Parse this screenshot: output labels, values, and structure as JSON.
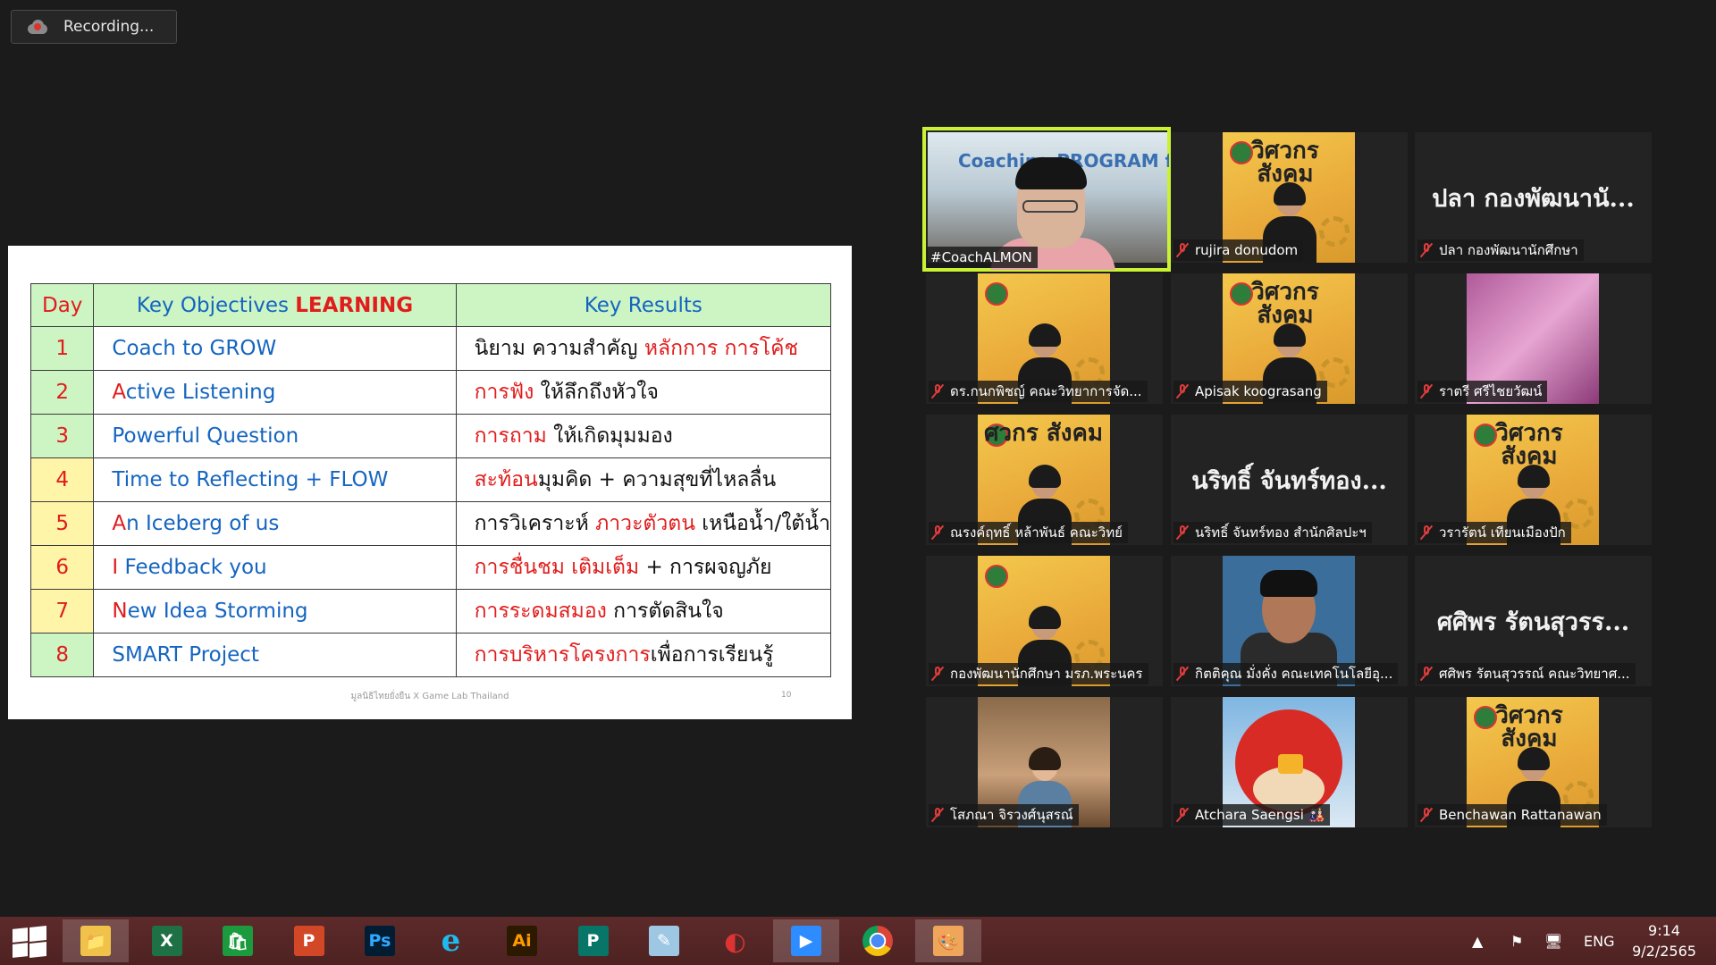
{
  "recording": {
    "label": "Recording..."
  },
  "slide": {
    "header": {
      "day": "Day",
      "objectives_prefix": "Key Objectives ",
      "objectives_highlight": "LEARNING",
      "results": "Key Results"
    },
    "rows": [
      {
        "day": "1",
        "obj_a": "",
        "obj_b": "Coach to GROW",
        "res_a": "นิยาม ความสำคัญ ",
        "res_b": "หลักการ การโค้ช",
        "res_c": ""
      },
      {
        "day": "2",
        "obj_a": "A",
        "obj_b": "ctive Listening",
        "res_a": "",
        "res_b": "การฟัง",
        "res_c": " ให้ลึกถึงหัวใจ"
      },
      {
        "day": "3",
        "obj_a": "",
        "obj_b": "Powerful Question",
        "res_a": "",
        "res_b": "การถาม",
        "res_c": " ให้เกิดมุมมอง"
      },
      {
        "day": "4",
        "obj_a": "",
        "obj_b": "Time to Reflecting + FLOW",
        "res_a": "",
        "res_b": "สะท้อน",
        "res_c": "มุมคิด + ความสุขที่ไหลลื่น"
      },
      {
        "day": "5",
        "obj_a": "A",
        "obj_b": "n Iceberg of us",
        "res_a": "การวิเคราะห์ ",
        "res_b": "ภาวะตัวตน",
        "res_c": " เหนือน้ำ/ใต้น้ำ"
      },
      {
        "day": "6",
        "obj_a": "I",
        "obj_b": " Feedback you",
        "res_a": "",
        "res_b": "การชื่นชม เติมเต็ม",
        "res_c": " + การผจญภัย"
      },
      {
        "day": "7",
        "obj_a": "N",
        "obj_b": "ew Idea Storming",
        "res_a": "",
        "res_b": "การระดมสมอง",
        "res_c": " การตัดสินใจ"
      },
      {
        "day": "8",
        "obj_a": "",
        "obj_b": "SMART Project",
        "res_a": "",
        "res_b": "การบริหารโครงการ",
        "res_c": "เพื่อการเรียนรู้"
      }
    ],
    "footer": "มูลนิธิไทยยั่งยืน X Game Lab Thailand",
    "page": "10"
  },
  "participants": [
    {
      "name": "#CoachALMON",
      "muted": false,
      "kind": "video",
      "overlay": "Coaching PROGRAM for Leader"
    },
    {
      "name": "rujira donudom",
      "muted": true,
      "kind": "poster",
      "poster_text": "วิศวกร สังคม"
    },
    {
      "name": "ปลา กองพัฒนานักศึกษา",
      "muted": true,
      "kind": "text",
      "big": "ปลา กองพัฒนานั..."
    },
    {
      "name": "ดร.กนกพิชญ์ คณะวิทยาการจัด...",
      "muted": true,
      "kind": "poster",
      "poster_text": ""
    },
    {
      "name": "Apisak koograsang",
      "muted": true,
      "kind": "poster",
      "poster_text": "วิศวกร สังคม"
    },
    {
      "name": "ราตรี ศรีไชยวัฒน์",
      "muted": true,
      "kind": "photo"
    },
    {
      "name": "ณรงค์ฤทธิ์ หล้าพันธ์ คณะวิทย์",
      "muted": true,
      "kind": "poster",
      "poster_text": "ศวกร สังคม"
    },
    {
      "name": "นริทธิ์ จันทร์ทอง สำนักศิลปะฯ",
      "muted": true,
      "kind": "text",
      "big": "นริทธิ์ จันทร์ทอง..."
    },
    {
      "name": "วรารัตน์ เทียนเมืองปัก",
      "muted": true,
      "kind": "poster",
      "poster_text": "วิศวกร สังคม"
    },
    {
      "name": "กองพัฒนานักศึกษา มรภ.พระนคร",
      "muted": true,
      "kind": "poster",
      "poster_text": ""
    },
    {
      "name": "กิตติคุณ มั่งคั่ง คณะเทคโนโลยีอุ...",
      "muted": true,
      "kind": "avatar"
    },
    {
      "name": "ศศิพร รัตนสุวรรณ์ คณะวิทยาศ...",
      "muted": true,
      "kind": "text",
      "big": "ศศิพร รัตนสุวรร..."
    },
    {
      "name": "โสภณา จิรวงศ์นุสรณ์",
      "muted": true,
      "kind": "photo"
    },
    {
      "name": "Atchara Saengsi 🎎",
      "muted": true,
      "kind": "bird"
    },
    {
      "name": "Benchawan Rattanawan",
      "muted": true,
      "kind": "poster",
      "poster_text": "วิศวกร สังคม"
    }
  ],
  "taskbar": {
    "apps": [
      "file-explorer",
      "excel",
      "store",
      "powerpoint",
      "photoshop",
      "internet-explorer",
      "illustrator",
      "publisher",
      "notepad",
      "photoscape",
      "zoom",
      "chrome",
      "paint"
    ],
    "labels": {
      "excel": "X",
      "powerpoint": "P",
      "photoshop": "Ps",
      "illustrator": "Ai",
      "publisher": "P"
    },
    "language": "ENG",
    "time": "9:14",
    "date": "9/2/2565"
  }
}
